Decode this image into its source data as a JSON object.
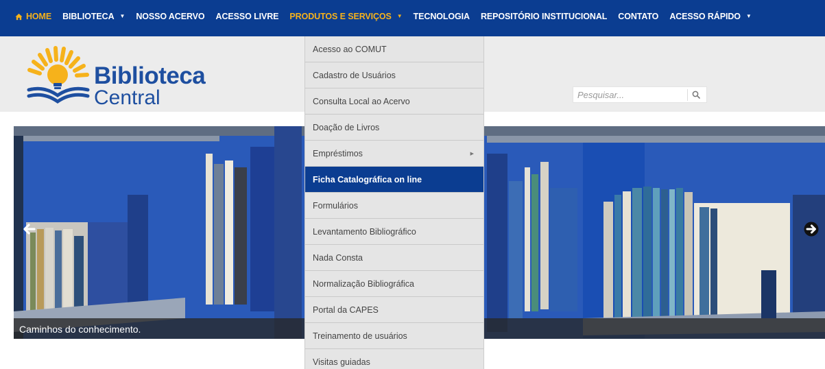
{
  "colors": {
    "nav_bg": "#0b3d91",
    "nav_text": "#ffffff",
    "nav_active": "#f6b21b",
    "header_bg": "#ececec",
    "logo_blue": "#1e4fa0",
    "logo_yellow": "#f6b21b",
    "menu_bg": "#e5e5e5",
    "menu_highlight": "#0b3d91"
  },
  "nav": {
    "items": [
      {
        "label": "HOME",
        "icon": "home-icon",
        "active": true
      },
      {
        "label": "BIBLIOTECA",
        "dropdown": true
      },
      {
        "label": "NOSSO ACERVO"
      },
      {
        "label": "ACESSO LIVRE"
      },
      {
        "label": "PRODUTOS E SERVIÇOS",
        "dropdown": true,
        "active": true
      },
      {
        "label": "TECNOLOGIA"
      },
      {
        "label": "REPOSITÓRIO INSTITUCIONAL"
      },
      {
        "label": "CONTATO"
      },
      {
        "label": "ACESSO RÁPIDO",
        "dropdown": true
      }
    ]
  },
  "logo": {
    "line1": "Biblioteca",
    "line2": "Central"
  },
  "search": {
    "placeholder": "Pesquisar...",
    "icon": "search-icon"
  },
  "slider": {
    "caption": "Caminhos do conhecimento.",
    "prev_icon": "arrow-left-icon",
    "next_icon": "arrow-right-icon"
  },
  "dropdown": {
    "parent": "PRODUTOS E SERVIÇOS",
    "items": [
      {
        "label": "Acesso ao COMUT"
      },
      {
        "label": "Cadastro de Usuários"
      },
      {
        "label": "Consulta Local ao Acervo"
      },
      {
        "label": "Doação de Livros"
      },
      {
        "label": "Empréstimos",
        "submenu": true
      },
      {
        "label": "Ficha Catalográfica on line",
        "highlighted": true
      },
      {
        "label": "Formulários"
      },
      {
        "label": "Levantamento Bibliográfico"
      },
      {
        "label": "Nada Consta"
      },
      {
        "label": "Normalização Bibliográfica"
      },
      {
        "label": "Portal da CAPES"
      },
      {
        "label": "Treinamento de usuários"
      },
      {
        "label": "Visitas guiadas"
      }
    ]
  }
}
